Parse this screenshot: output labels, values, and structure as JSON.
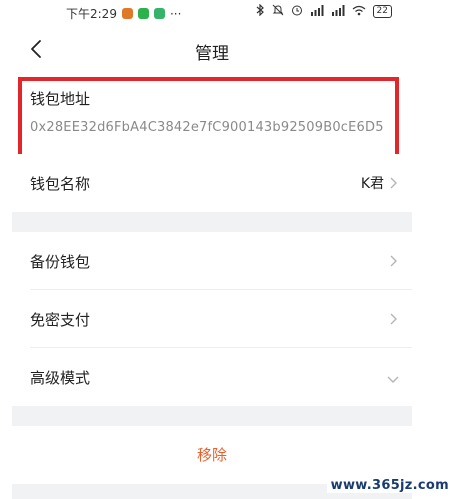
{
  "status_bar": {
    "time": "下午2:29",
    "dots": "···",
    "battery": "22"
  },
  "header": {
    "title": "管理"
  },
  "wallet_address": {
    "label": "钱包地址",
    "value": "0x28EE32d6FbA4C3842e7fC900143b92509B0cE6D5"
  },
  "wallet_name": {
    "label": "钱包名称",
    "value": "K君"
  },
  "settings": {
    "backup_label": "备份钱包",
    "password_free_label": "免密支付",
    "advanced_label": "高级模式"
  },
  "actions": {
    "remove_label": "移除"
  },
  "watermark": "www.365jz.com",
  "colors": {
    "highlight": "#e3262a",
    "danger": "#e8602c",
    "background": "#f1f2f4"
  }
}
